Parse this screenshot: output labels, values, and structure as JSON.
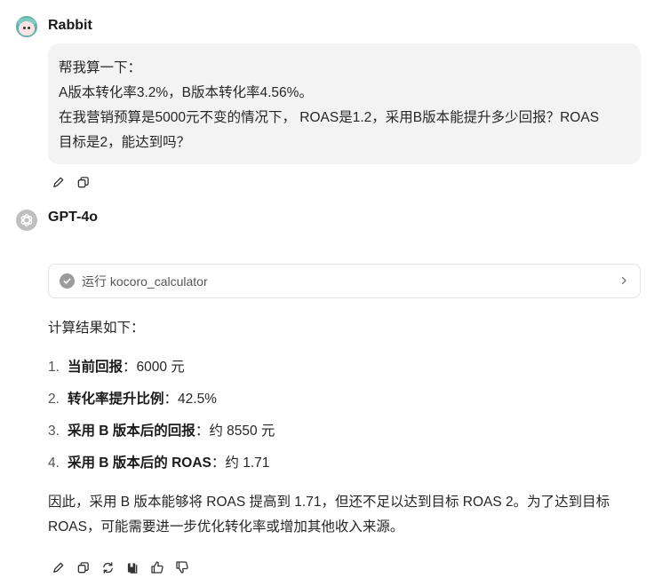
{
  "user": {
    "name": "Rabbit",
    "message_lines": [
      "帮我算一下：",
      "A版本转化率3.2%，B版本转化率4.56%。",
      "在我营销预算是5000元不变的情况下， ROAS是1.2，采用B版本能提升多少回报？ROAS",
      "目标是2，能达到吗？"
    ]
  },
  "assistant": {
    "name": "GPT-4o",
    "tool_call_label": "运行 kocoro_calculator",
    "intro": "计算结果如下：",
    "results": [
      {
        "num": "1.",
        "label": "当前回报",
        "value": "：6000 元"
      },
      {
        "num": "2.",
        "label": "转化率提升比例",
        "value": "：42.5%"
      },
      {
        "num": "3.",
        "label": "采用 B 版本后的回报",
        "value": "：约 8550 元"
      },
      {
        "num": "4.",
        "label": "采用 B 版本后的 ROAS",
        "value": "：约 1.71"
      }
    ],
    "conclusion_lines": [
      "因此，采用 B 版本能够将 ROAS 提高到 1.71，但还不足以达到目标 ROAS 2。为了达到目标",
      "ROAS，可能需要进一步优化转化率或增加其他收入来源。"
    ]
  },
  "icons": {
    "edit": "pencil-icon",
    "copy": "copy-icon",
    "regenerate": "refresh-icon",
    "save": "bookmark-icon",
    "like": "thumbs-up-icon",
    "dislike": "thumbs-down-icon",
    "tool_status": "check-circle-icon",
    "expand": "chevron-right-icon"
  }
}
